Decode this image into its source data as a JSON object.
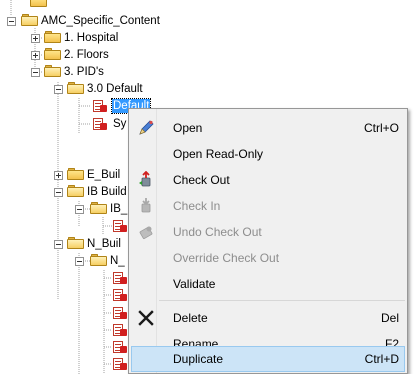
{
  "tree": {
    "root": "AMC_Specific_Content",
    "nodes": [
      {
        "id": "hospital",
        "label": "1. Hospital"
      },
      {
        "id": "floors",
        "label": "2. Floors"
      },
      {
        "id": "pids",
        "label": "3. PID's"
      },
      {
        "id": "default30",
        "label": "3.0 Default"
      },
      {
        "id": "default_item",
        "label": "Default"
      },
      {
        "id": "sy_item",
        "label": "Sy"
      },
      {
        "id": "e_buil",
        "label": "E_Buil"
      },
      {
        "id": "ib_build",
        "label": "IB Build"
      },
      {
        "id": "ib_sub",
        "label": "IB_"
      },
      {
        "id": "n_buil",
        "label": "N_Buil"
      },
      {
        "id": "n_sub",
        "label": "N_"
      }
    ]
  },
  "context_menu": {
    "items": [
      {
        "label": "Open",
        "shortcut": "Ctrl+O",
        "enabled": true,
        "icon": "pencil-edit-icon"
      },
      {
        "label": "Open Read-Only",
        "shortcut": "",
        "enabled": true,
        "icon": ""
      },
      {
        "label": "Check Out",
        "shortcut": "",
        "enabled": true,
        "icon": "check-out-icon"
      },
      {
        "label": "Check In",
        "shortcut": "",
        "enabled": false,
        "icon": "check-in-icon"
      },
      {
        "label": "Undo Check Out",
        "shortcut": "",
        "enabled": false,
        "icon": "undo-check-out-icon"
      },
      {
        "label": "Override Check Out",
        "shortcut": "",
        "enabled": false,
        "icon": ""
      },
      {
        "label": "Validate",
        "shortcut": "",
        "enabled": true,
        "icon": ""
      },
      {
        "label": "Delete",
        "shortcut": "Del",
        "enabled": true,
        "icon": "delete-x-icon"
      },
      {
        "label": "Rename",
        "shortcut": "F2",
        "enabled": true,
        "icon": ""
      },
      {
        "label": "Duplicate",
        "shortcut": "Ctrl+D",
        "enabled": true,
        "icon": "",
        "highlighted": true
      }
    ]
  },
  "colors": {
    "selection": "#3399ff",
    "menu_hover": "#cce4f7",
    "menu_bg": "#f0f0f0",
    "disabled_text": "#8d8d8d"
  }
}
